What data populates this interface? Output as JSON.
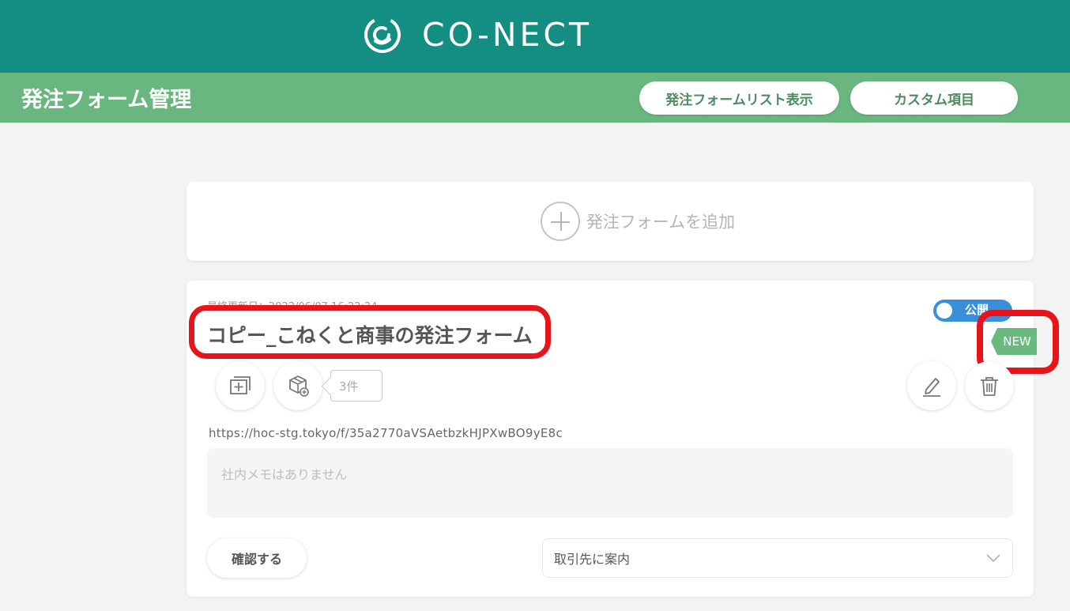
{
  "header": {
    "logo_text": "CO-NECT",
    "colors": {
      "teal": "#148e82",
      "green": "#69b77f",
      "accent_red": "#e8141c",
      "toggle_blue": "#3a8fd9"
    }
  },
  "subheader": {
    "title": "発注フォーム管理",
    "list_button": "発注フォームリスト表示",
    "custom_button": "カスタム項目"
  },
  "add_form": {
    "label": "発注フォームを追加",
    "icon": "plus-circle-icon"
  },
  "form_card": {
    "updated": "最終更新日：2022/06/07 16:22:24",
    "name": "コピー_こねくと商事の発注フォーム",
    "toggle_label": "公開",
    "new_badge": "NEW",
    "product_count": "3件",
    "url": "https://hoc-stg.tokyo/f/35a2770aVSAetbzkHJPXwBO9yE8c",
    "memo_placeholder": "社内メモはありません",
    "confirm_button": "確認する",
    "guide_select": "取引先に案内",
    "icons": [
      "add-window-icon",
      "product-box-icon",
      "edit-pen-icon",
      "trash-icon",
      "chevron-down-icon"
    ]
  }
}
